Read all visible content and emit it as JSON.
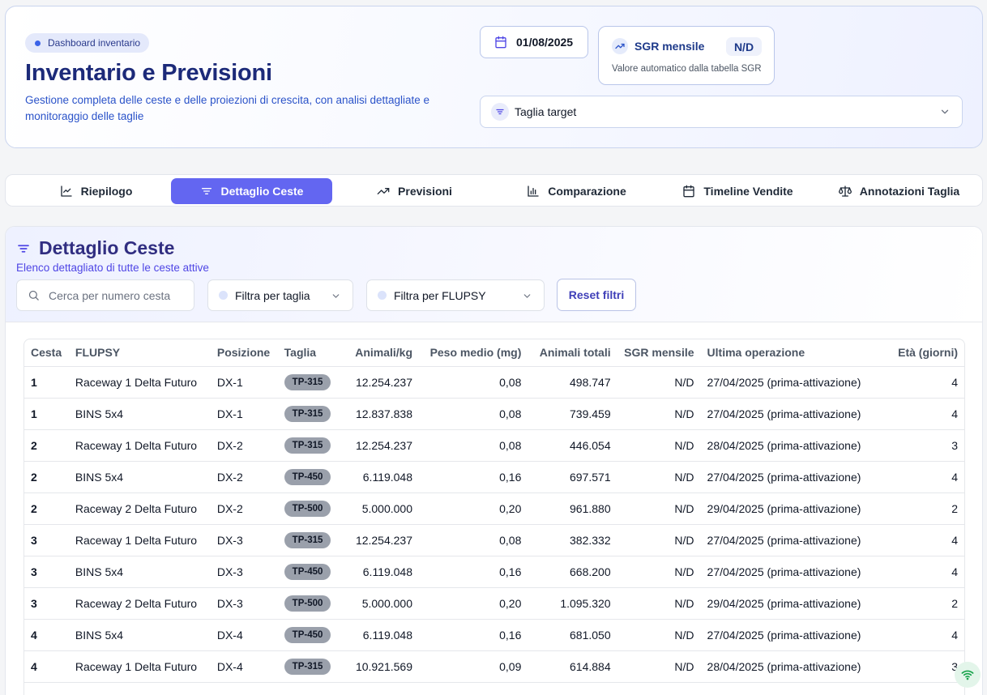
{
  "header": {
    "badge": "Dashboard inventario",
    "title": "Inventario e Previsioni",
    "subtitle": "Gestione completa delle ceste e delle proiezioni di crescita, con analisi dettagliate e monitoraggio delle taglie",
    "date": "01/08/2025",
    "sgr": {
      "label": "SGR mensile",
      "value": "N/D",
      "caption": "Valore automatico dalla tabella SGR"
    },
    "taglia_select": "Taglia target"
  },
  "tabs": [
    {
      "label": "Riepilogo",
      "icon": "line-chart-icon"
    },
    {
      "label": "Dettaglio Ceste",
      "icon": "filter-icon",
      "active": true
    },
    {
      "label": "Previsioni",
      "icon": "trending-up-icon"
    },
    {
      "label": "Comparazione",
      "icon": "bar-chart-icon"
    },
    {
      "label": "Timeline Vendite",
      "icon": "calendar-icon"
    },
    {
      "label": "Annotazioni Taglia",
      "icon": "scale-icon"
    }
  ],
  "section": {
    "title": "Dettaglio Ceste",
    "subtitle": "Elenco dettagliato di tutte le ceste attive",
    "search_placeholder": "Cerca per numero cesta",
    "filter_taglia": "Filtra per taglia",
    "filter_flupsy": "Filtra per FLUPSY",
    "reset": "Reset filtri"
  },
  "table": {
    "columns": [
      "Cesta",
      "FLUPSY",
      "Posizione",
      "Taglia",
      "Animali/kg",
      "Peso medio (mg)",
      "Animali totali",
      "SGR mensile",
      "Ultima operazione",
      "Età (giorni)"
    ],
    "rows": [
      [
        "1",
        "Raceway 1 Delta Futuro",
        "DX-1",
        "TP-315",
        "12.254.237",
        "0,08",
        "498.747",
        "N/D",
        "27/04/2025 (prima-attivazione)",
        "4"
      ],
      [
        "1",
        "BINS 5x4",
        "DX-1",
        "TP-315",
        "12.837.838",
        "0,08",
        "739.459",
        "N/D",
        "27/04/2025 (prima-attivazione)",
        "4"
      ],
      [
        "2",
        "Raceway 1 Delta Futuro",
        "DX-2",
        "TP-315",
        "12.254.237",
        "0,08",
        "446.054",
        "N/D",
        "28/04/2025 (prima-attivazione)",
        "3"
      ],
      [
        "2",
        "BINS 5x4",
        "DX-2",
        "TP-450",
        "6.119.048",
        "0,16",
        "697.571",
        "N/D",
        "27/04/2025 (prima-attivazione)",
        "4"
      ],
      [
        "2",
        "Raceway 2 Delta Futuro",
        "DX-2",
        "TP-500",
        "5.000.000",
        "0,20",
        "961.880",
        "N/D",
        "29/04/2025 (prima-attivazione)",
        "2"
      ],
      [
        "3",
        "Raceway 1 Delta Futuro",
        "DX-3",
        "TP-315",
        "12.254.237",
        "0,08",
        "382.332",
        "N/D",
        "27/04/2025 (prima-attivazione)",
        "4"
      ],
      [
        "3",
        "BINS 5x4",
        "DX-3",
        "TP-450",
        "6.119.048",
        "0,16",
        "668.200",
        "N/D",
        "27/04/2025 (prima-attivazione)",
        "4"
      ],
      [
        "3",
        "Raceway 2 Delta Futuro",
        "DX-3",
        "TP-500",
        "5.000.000",
        "0,20",
        "1.095.320",
        "N/D",
        "29/04/2025 (prima-attivazione)",
        "2"
      ],
      [
        "4",
        "BINS 5x4",
        "DX-4",
        "TP-450",
        "6.119.048",
        "0,16",
        "681.050",
        "N/D",
        "27/04/2025 (prima-attivazione)",
        "4"
      ],
      [
        "4",
        "Raceway 1 Delta Futuro",
        "DX-4",
        "TP-315",
        "10.921.569",
        "0,09",
        "614.884",
        "N/D",
        "28/04/2025 (prima-attivazione)",
        "3"
      ]
    ]
  },
  "colors": {
    "accent": "#6366f1",
    "title": "#1c2a79",
    "pill": "#9aa0ab"
  }
}
